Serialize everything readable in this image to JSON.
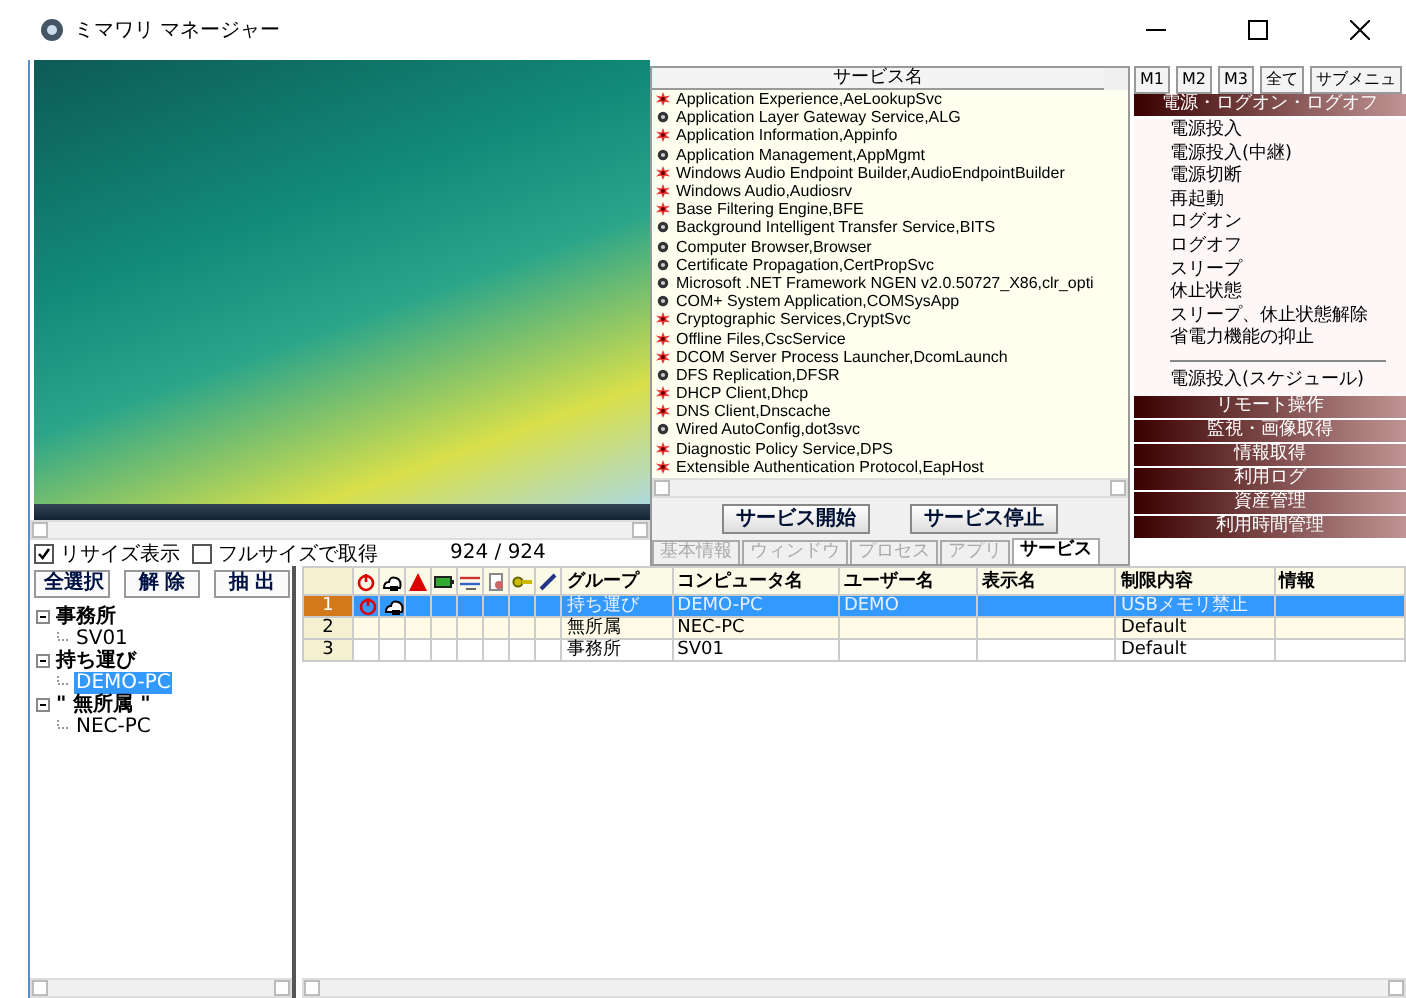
{
  "window": {
    "title": "ミマワリ マネージャー"
  },
  "screen_options": {
    "resize": {
      "label": "リサイズ表示",
      "checked": true
    },
    "fullsize": {
      "label": "フルサイズで取得",
      "checked": false
    },
    "count": "924 / 924"
  },
  "services": {
    "header": "サービス名",
    "items": [
      {
        "name": "Application Experience,AeLookupSvc",
        "running": true
      },
      {
        "name": "Application Layer Gateway Service,ALG",
        "running": false
      },
      {
        "name": "Application Information,Appinfo",
        "running": true
      },
      {
        "name": "Application Management,AppMgmt",
        "running": false
      },
      {
        "name": "Windows Audio Endpoint Builder,AudioEndpointBuilder",
        "running": true
      },
      {
        "name": "Windows Audio,Audiosrv",
        "running": true
      },
      {
        "name": "Base Filtering Engine,BFE",
        "running": true
      },
      {
        "name": "Background Intelligent Transfer Service,BITS",
        "running": false
      },
      {
        "name": "Computer Browser,Browser",
        "running": false
      },
      {
        "name": "Certificate Propagation,CertPropSvc",
        "running": false
      },
      {
        "name": "Microsoft .NET Framework NGEN v2.0.50727_X86,clr_opti",
        "running": false
      },
      {
        "name": "COM+ System Application,COMSysApp",
        "running": false
      },
      {
        "name": "Cryptographic Services,CryptSvc",
        "running": true
      },
      {
        "name": "Offline Files,CscService",
        "running": true
      },
      {
        "name": "DCOM Server Process Launcher,DcomLaunch",
        "running": true
      },
      {
        "name": "DFS Replication,DFSR",
        "running": false
      },
      {
        "name": "DHCP Client,Dhcp",
        "running": true
      },
      {
        "name": "DNS Client,Dnscache",
        "running": true
      },
      {
        "name": "Wired AutoConfig,dot3svc",
        "running": false
      },
      {
        "name": "Diagnostic Policy Service,DPS",
        "running": true
      },
      {
        "name": "Extensible Authentication Protocol,EapHost",
        "running": true
      }
    ],
    "buttons": [
      "サービス開始",
      "サービス停止"
    ]
  },
  "info_tabs": [
    {
      "label": "基本情報",
      "selected": false
    },
    {
      "label": "ウィンドウ",
      "selected": false
    },
    {
      "label": "プロセス",
      "selected": false
    },
    {
      "label": "アプリ",
      "selected": false
    },
    {
      "label": "サービス",
      "selected": true
    }
  ],
  "menu_buttons": [
    "M1",
    "M2",
    "M3",
    "全て",
    "サブメニュ"
  ],
  "menu_sections": [
    {
      "title": "電源・ログオン・ログオフ",
      "expanded": true,
      "items": [
        {
          "kind": "command",
          "label": "電源投入"
        },
        {
          "kind": "command",
          "label": "電源投入(中継)"
        },
        {
          "kind": "command",
          "label": "電源切断"
        },
        {
          "kind": "command",
          "label": "再起動"
        },
        {
          "kind": "command",
          "label": "ログオン"
        },
        {
          "kind": "command",
          "label": "ログオフ"
        },
        {
          "kind": "command",
          "label": "スリープ"
        },
        {
          "kind": "command",
          "label": "休止状態"
        },
        {
          "kind": "command",
          "label": "スリープ、休止状態解除"
        },
        {
          "kind": "command",
          "label": "省電力機能の抑止"
        },
        {
          "kind": "separator"
        },
        {
          "kind": "command",
          "label": "電源投入(スケジュール)"
        }
      ]
    },
    {
      "title": "リモート操作",
      "expanded": false
    },
    {
      "title": "監視・画像取得",
      "expanded": false
    },
    {
      "title": "情報取得",
      "expanded": false
    },
    {
      "title": "利用ログ",
      "expanded": false
    },
    {
      "title": "資産管理",
      "expanded": false
    },
    {
      "title": "利用時間管理",
      "expanded": false
    }
  ],
  "tree_buttons": [
    "全選択",
    "解 除",
    "抽 出"
  ],
  "tree": [
    {
      "label": "事務所",
      "expanded": true,
      "selected": false,
      "children": [
        {
          "label": "SV01",
          "selected": false
        }
      ]
    },
    {
      "label": "持ち運び",
      "expanded": true,
      "selected": false,
      "children": [
        {
          "label": "DEMO-PC",
          "selected": true
        }
      ]
    },
    {
      "label": "\" 無所属 \"",
      "expanded": true,
      "selected": false,
      "children": [
        {
          "label": "NEC-PC",
          "selected": false
        }
      ]
    }
  ],
  "table": {
    "columns": [
      "グループ",
      "コンピュータ名",
      "ユーザー名",
      "表示名",
      "制限内容",
      "情報"
    ],
    "rows": [
      {
        "number": "1",
        "selected": true,
        "power_on": true,
        "connected": true,
        "group": "持ち運び",
        "computer": "DEMO-PC",
        "user": "DEMO",
        "restriction": "USBメモリ禁止"
      },
      {
        "number": "2",
        "selected": false,
        "power_on": false,
        "connected": false,
        "group": "無所属",
        "computer": "NEC-PC",
        "user": "",
        "restriction": "Default"
      },
      {
        "number": "3",
        "selected": false,
        "power_on": false,
        "connected": false,
        "group": "事務所",
        "computer": "SV01",
        "user": "",
        "restriction": "Default"
      }
    ]
  }
}
